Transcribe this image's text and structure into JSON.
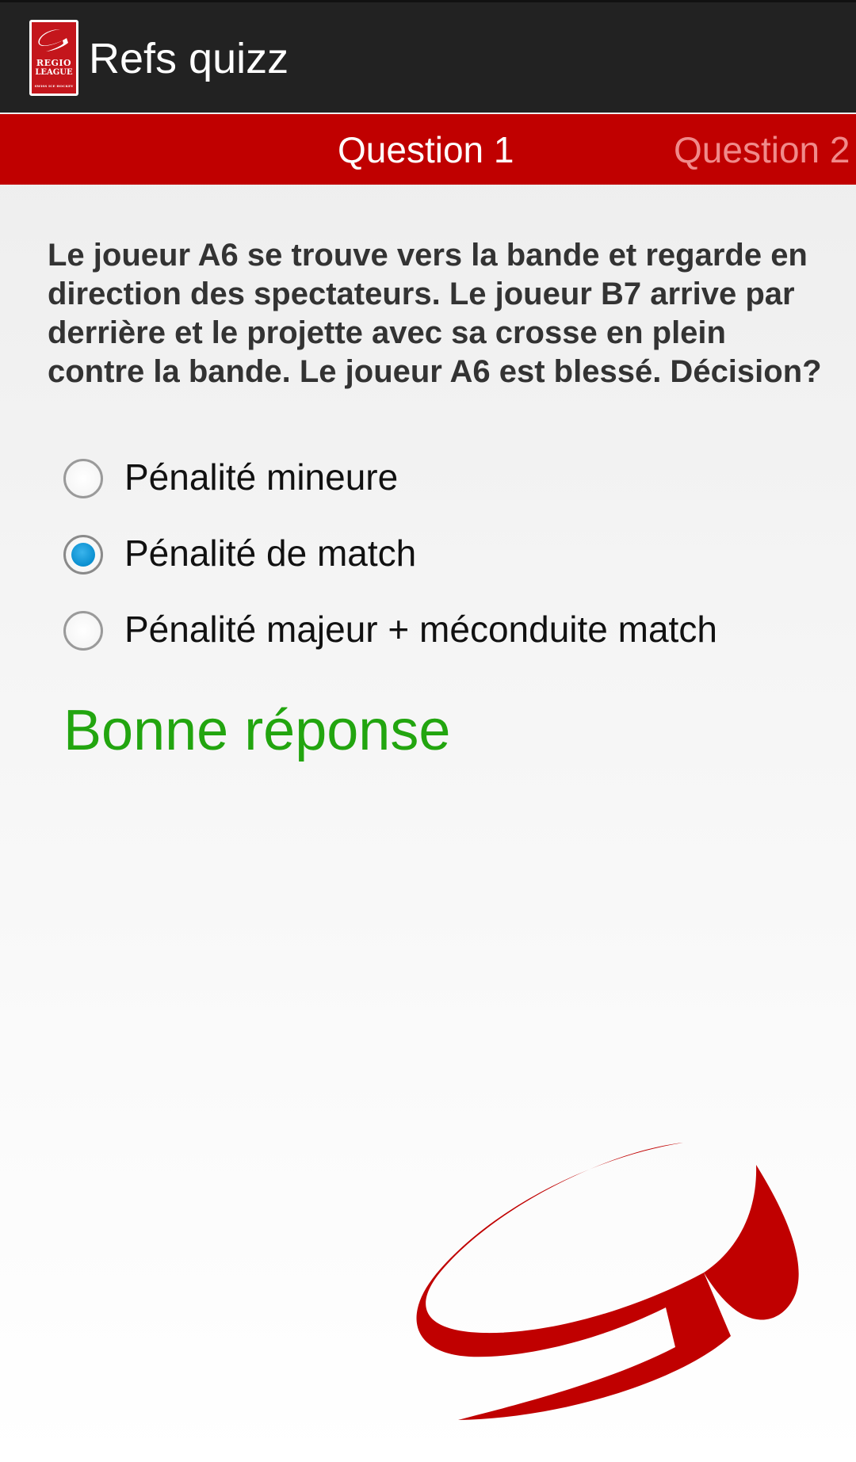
{
  "app": {
    "title": "Refs quizz",
    "logo": {
      "line1": "REGIO",
      "line2": "LEAGUE",
      "line3": "SWISS ICE HOCKEY"
    }
  },
  "tabs": [
    {
      "label": "Question 1",
      "selected": true
    },
    {
      "label": "Question 2",
      "selected": false
    }
  ],
  "question": {
    "text": "Le joueur A6 se trouve vers la bande et regarde en direction des spectateurs. Le joueur B7 arrive par derrière et le projette avec sa crosse en plein contre la bande. Le joueur A6 est blessé. Décision?"
  },
  "options": [
    {
      "label": "Pénalité mineure",
      "checked": false
    },
    {
      "label": "Pénalité de match",
      "checked": true
    },
    {
      "label": "Pénalité majeur + méconduite match",
      "checked": false
    }
  ],
  "result": {
    "text": "Bonne réponse"
  },
  "colors": {
    "action_bar": "#222222",
    "tab_strip": "#c00000",
    "tab_inactive_text": "#f08a8a",
    "result_green": "#22a50f",
    "radio_checked": "#0a8fd0",
    "brand_red": "#c4161c"
  },
  "icons": {
    "app_logo": "regio-league-logo-icon",
    "watermark": "regio-league-swirl-icon"
  }
}
